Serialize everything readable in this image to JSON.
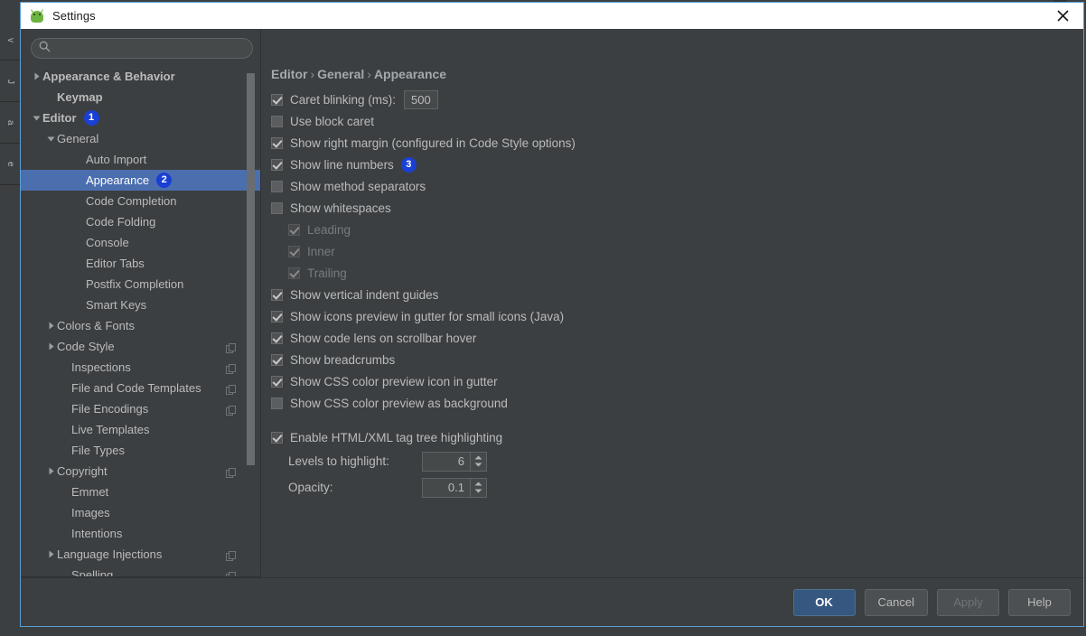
{
  "window": {
    "title": "Settings",
    "app_icon": "android-studio-icon",
    "close_icon": "close-icon",
    "accent_border": "#5a9fd4"
  },
  "ide_backdrop": {
    "left_tabs": [
      "v",
      "J",
      "a",
      "e"
    ],
    "background": "#3c3f41"
  },
  "search": {
    "icon": "search-icon",
    "value": "",
    "placeholder": ""
  },
  "sidebar": {
    "scrollbar": "vertical-scrollbar",
    "items": [
      {
        "label": "Appearance & Behavior",
        "indent": 0,
        "arrow": "collapsed",
        "bold": true,
        "selected": false,
        "copy": false,
        "badge": null
      },
      {
        "label": "Keymap",
        "indent": 1,
        "arrow": "none",
        "bold": true,
        "selected": false,
        "copy": false,
        "badge": null
      },
      {
        "label": "Editor",
        "indent": 0,
        "arrow": "expanded",
        "bold": true,
        "selected": false,
        "copy": false,
        "badge": "1"
      },
      {
        "label": "General",
        "indent": 1,
        "arrow": "expanded",
        "bold": false,
        "selected": false,
        "copy": false,
        "badge": null
      },
      {
        "label": "Auto Import",
        "indent": 3,
        "arrow": "none",
        "bold": false,
        "selected": false,
        "copy": false,
        "badge": null
      },
      {
        "label": "Appearance",
        "indent": 3,
        "arrow": "none",
        "bold": false,
        "selected": true,
        "copy": false,
        "badge": "2"
      },
      {
        "label": "Code Completion",
        "indent": 3,
        "arrow": "none",
        "bold": false,
        "selected": false,
        "copy": false,
        "badge": null
      },
      {
        "label": "Code Folding",
        "indent": 3,
        "arrow": "none",
        "bold": false,
        "selected": false,
        "copy": false,
        "badge": null
      },
      {
        "label": "Console",
        "indent": 3,
        "arrow": "none",
        "bold": false,
        "selected": false,
        "copy": false,
        "badge": null
      },
      {
        "label": "Editor Tabs",
        "indent": 3,
        "arrow": "none",
        "bold": false,
        "selected": false,
        "copy": false,
        "badge": null
      },
      {
        "label": "Postfix Completion",
        "indent": 3,
        "arrow": "none",
        "bold": false,
        "selected": false,
        "copy": false,
        "badge": null
      },
      {
        "label": "Smart Keys",
        "indent": 3,
        "arrow": "none",
        "bold": false,
        "selected": false,
        "copy": false,
        "badge": null
      },
      {
        "label": "Colors & Fonts",
        "indent": 1,
        "arrow": "collapsed",
        "bold": false,
        "selected": false,
        "copy": false,
        "badge": null
      },
      {
        "label": "Code Style",
        "indent": 1,
        "arrow": "collapsed",
        "bold": false,
        "selected": false,
        "copy": true,
        "badge": null
      },
      {
        "label": "Inspections",
        "indent": 2,
        "arrow": "none",
        "bold": false,
        "selected": false,
        "copy": true,
        "badge": null
      },
      {
        "label": "File and Code Templates",
        "indent": 2,
        "arrow": "none",
        "bold": false,
        "selected": false,
        "copy": true,
        "badge": null
      },
      {
        "label": "File Encodings",
        "indent": 2,
        "arrow": "none",
        "bold": false,
        "selected": false,
        "copy": true,
        "badge": null
      },
      {
        "label": "Live Templates",
        "indent": 2,
        "arrow": "none",
        "bold": false,
        "selected": false,
        "copy": false,
        "badge": null
      },
      {
        "label": "File Types",
        "indent": 2,
        "arrow": "none",
        "bold": false,
        "selected": false,
        "copy": false,
        "badge": null
      },
      {
        "label": "Copyright",
        "indent": 1,
        "arrow": "collapsed",
        "bold": false,
        "selected": false,
        "copy": true,
        "badge": null
      },
      {
        "label": "Emmet",
        "indent": 2,
        "arrow": "none",
        "bold": false,
        "selected": false,
        "copy": false,
        "badge": null
      },
      {
        "label": "Images",
        "indent": 2,
        "arrow": "none",
        "bold": false,
        "selected": false,
        "copy": false,
        "badge": null
      },
      {
        "label": "Intentions",
        "indent": 2,
        "arrow": "none",
        "bold": false,
        "selected": false,
        "copy": false,
        "badge": null
      },
      {
        "label": "Language Injections",
        "indent": 1,
        "arrow": "collapsed",
        "bold": false,
        "selected": false,
        "copy": true,
        "badge": null
      },
      {
        "label": "Spelling",
        "indent": 2,
        "arrow": "none",
        "bold": false,
        "selected": false,
        "copy": true,
        "badge": null
      }
    ]
  },
  "content": {
    "breadcrumb": [
      "Editor",
      "General",
      "Appearance"
    ],
    "breadcrumb_separator": "›",
    "options": [
      {
        "label": "Caret blinking (ms):",
        "state": "checked",
        "disabled": false,
        "indent": 0,
        "badge": null,
        "field": "500"
      },
      {
        "label": "Use block caret",
        "state": "unchecked",
        "disabled": false,
        "indent": 0,
        "badge": null,
        "field": null
      },
      {
        "label": "Show right margin (configured in Code Style options)",
        "state": "checked",
        "disabled": false,
        "indent": 0,
        "badge": null,
        "field": null
      },
      {
        "label": "Show line numbers",
        "state": "checked",
        "disabled": false,
        "indent": 0,
        "badge": "3",
        "field": null
      },
      {
        "label": "Show method separators",
        "state": "unchecked",
        "disabled": false,
        "indent": 0,
        "badge": null,
        "field": null
      },
      {
        "label": "Show whitespaces",
        "state": "unchecked",
        "disabled": false,
        "indent": 0,
        "badge": null,
        "field": null
      },
      {
        "label": "Leading",
        "state": "checked",
        "disabled": true,
        "indent": 1,
        "badge": null,
        "field": null
      },
      {
        "label": "Inner",
        "state": "checked",
        "disabled": true,
        "indent": 1,
        "badge": null,
        "field": null
      },
      {
        "label": "Trailing",
        "state": "checked",
        "disabled": true,
        "indent": 1,
        "badge": null,
        "field": null
      },
      {
        "label": "Show vertical indent guides",
        "state": "checked",
        "disabled": false,
        "indent": 0,
        "badge": null,
        "field": null
      },
      {
        "label": "Show icons preview in gutter for small icons (Java)",
        "state": "checked",
        "disabled": false,
        "indent": 0,
        "badge": null,
        "field": null
      },
      {
        "label": "Show code lens on scrollbar hover",
        "state": "checked",
        "disabled": false,
        "indent": 0,
        "badge": null,
        "field": null
      },
      {
        "label": "Show breadcrumbs",
        "state": "checked",
        "disabled": false,
        "indent": 0,
        "badge": null,
        "field": null
      },
      {
        "label": "Show CSS color preview icon in gutter",
        "state": "checked",
        "disabled": false,
        "indent": 0,
        "badge": null,
        "field": null
      },
      {
        "label": "Show CSS color preview as background",
        "state": "unchecked",
        "disabled": false,
        "indent": 0,
        "badge": null,
        "field": null
      }
    ],
    "html_section": {
      "label": "Enable HTML/XML tag tree highlighting",
      "state": "checked",
      "spinners": [
        {
          "label": "Levels to highlight:",
          "value": "6"
        },
        {
          "label": "Opacity:",
          "value": "0.1"
        }
      ]
    }
  },
  "footer": {
    "buttons": [
      {
        "label": "OK",
        "style": "primary",
        "disabled": false
      },
      {
        "label": "Cancel",
        "style": "default",
        "disabled": false
      },
      {
        "label": "Apply",
        "style": "default",
        "disabled": true
      },
      {
        "label": "Help",
        "style": "default",
        "disabled": false
      }
    ]
  }
}
